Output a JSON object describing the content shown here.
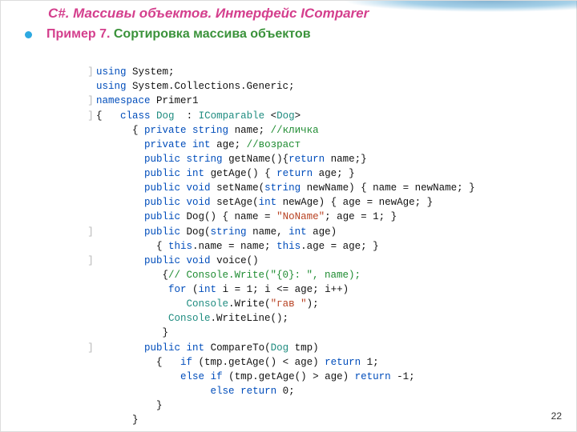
{
  "title": "C#. Массивы объектов. Интерфейс IComparer",
  "subtitle": {
    "ex": "Пример 7.",
    "desc": "Сортировка массива объектов"
  },
  "pageNumber": "22",
  "code": {
    "l1a": "using",
    "l1b": " System;",
    "l2a": "using",
    "l2b": " System.Collections.Generic;",
    "l3a": "namespace",
    "l3b": " Primer1",
    "l4a": "{   ",
    "l4b": "class",
    "l4c": "Dog",
    "l4d": "  : ",
    "l4e": "IComparable",
    "l4f": " <",
    "l4g": "Dog",
    "l4h": ">",
    "l5a": "      { ",
    "l5b": "private",
    "l5c": " ",
    "l5d": "string",
    "l5e": " name; ",
    "l5f": "//кличка",
    "l6a": "        ",
    "l6b": "private",
    "l6c": " ",
    "l6d": "int",
    "l6e": " age; ",
    "l6f": "//возраст",
    "l7a": "        ",
    "l7b": "public",
    "l7c": " ",
    "l7d": "string",
    "l7e": " getName(){",
    "l7f": "return",
    "l7g": " name;}",
    "l8a": "        ",
    "l8b": "public",
    "l8c": " ",
    "l8d": "int",
    "l8e": " getAge() { ",
    "l8f": "return",
    "l8g": " age; }",
    "l9a": "        ",
    "l9b": "public",
    "l9c": " ",
    "l9d": "void",
    "l9e": " setName(",
    "l9f": "string",
    "l9g": " newName) { name = newName; }",
    "l10a": "        ",
    "l10b": "public",
    "l10c": " ",
    "l10d": "void",
    "l10e": " setAge(",
    "l10f": "int",
    "l10g": " newAge) { age = newAge; }",
    "l11a": "        ",
    "l11b": "public",
    "l11c": " Dog() { name = ",
    "l11d": "\"NoName\"",
    "l11e": "; age = 1; }",
    "l12a": "        ",
    "l12b": "public",
    "l12c": " Dog(",
    "l12d": "string",
    "l12e": " name, ",
    "l12f": "int",
    "l12g": " age)",
    "l13txt": "          { ",
    "l13a": "this",
    "l13b": ".name = name; ",
    "l13c": "this",
    "l13d": ".age = age; }",
    "l14a": "        ",
    "l14b": "public",
    "l14c": " ",
    "l14d": "void",
    "l14e": " voice()",
    "l15a": "           {",
    "l15b": "// Console.Write(\"{0}: \", name);",
    "l16a": "            ",
    "l16b": "for",
    "l16c": " (",
    "l16d": "int",
    "l16e": " i = 1; i <= age; i++)",
    "l17a": "               ",
    "l17b": "Console",
    "l17c": ".Write(",
    "l17d": "\"гав \"",
    "l17e": ");",
    "l18a": "            ",
    "l18b": "Console",
    "l18c": ".WriteLine();",
    "l19": "           }",
    "l20a": "        ",
    "l20b": "public",
    "l20c": " ",
    "l20d": "int",
    "l20e": " CompareTo(",
    "l20f": "Dog",
    "l20g": " tmp)",
    "l21a": "          {   ",
    "l21b": "if",
    "l21c": " (tmp.getAge() < age) ",
    "l21d": "return",
    "l21e": " 1;",
    "l22a": "              ",
    "l22b": "else",
    "l22c": " ",
    "l22d": "if",
    "l22e": " (tmp.getAge() > age) ",
    "l22f": "return",
    "l22g": " -1;",
    "l23a": "                   ",
    "l23b": "else",
    "l23c": " ",
    "l23d": "return",
    "l23e": " 0;",
    "l24": "          }",
    "l25": "      }"
  }
}
